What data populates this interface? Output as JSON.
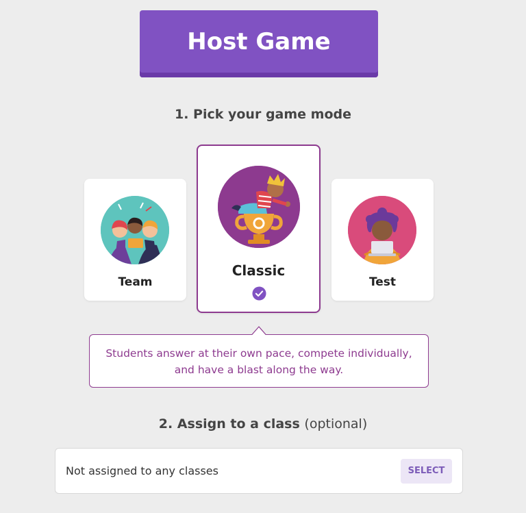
{
  "header": {
    "host_button_label": "Host Game"
  },
  "step1": {
    "title": "1. Pick your game mode"
  },
  "modes": [
    {
      "label": "Team",
      "icon": "team-illustration-icon",
      "selected": false
    },
    {
      "label": "Classic",
      "icon": "classic-trophy-illustration-icon",
      "selected": true
    },
    {
      "label": "Test",
      "icon": "test-laptop-illustration-icon",
      "selected": false
    }
  ],
  "description": {
    "line1": "Students answer at their own pace, compete individually,",
    "line2": "and have a blast along the way."
  },
  "step2": {
    "title": "2. Assign to a class",
    "optional": "(optional)"
  },
  "class_assignment": {
    "value": "Not assigned to any classes",
    "select_label": "SELECT"
  },
  "colors": {
    "background": "#ededed",
    "primary_purple": "#8052c2",
    "accent_magenta": "#8d3a8f",
    "team_circle": "#5ec4bd",
    "test_circle": "#d94b7b",
    "select_bg": "#ece6f6"
  }
}
